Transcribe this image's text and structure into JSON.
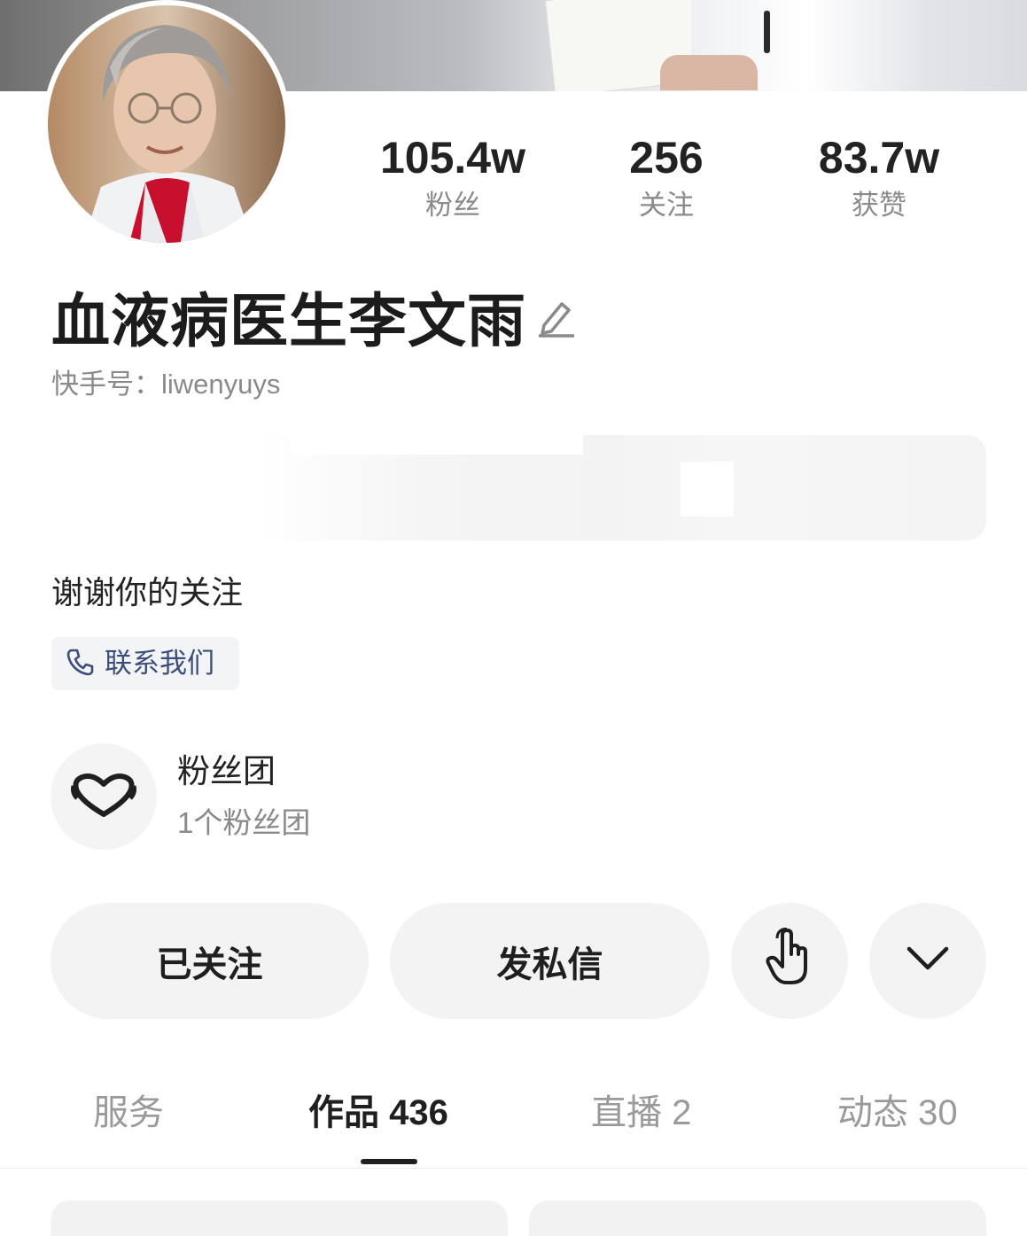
{
  "profile": {
    "name": "血液病医生李文雨",
    "kuaishou_id_label": "快手号：liwenyuys",
    "bio": "谢谢你的关注"
  },
  "stats": [
    {
      "value": "105.4w",
      "label": "粉丝"
    },
    {
      "value": "256",
      "label": "关注"
    },
    {
      "value": "83.7w",
      "label": "获赞"
    }
  ],
  "contact": {
    "label": "联系我们",
    "icon": "phone-icon"
  },
  "fan_club": {
    "title": "粉丝团",
    "subtitle": "1个粉丝团",
    "icon": "heart-icon"
  },
  "actions": {
    "follow_label": "已关注",
    "message_label": "发私信",
    "gesture_icon": "tap-hand-icon",
    "more_icon": "chevron-down-icon"
  },
  "tabs": [
    {
      "label": "服务",
      "active": false
    },
    {
      "label": "作品 436",
      "active": true
    },
    {
      "label": "直播 2",
      "active": false
    },
    {
      "label": "动态 30",
      "active": false
    }
  ],
  "colors": {
    "accent_link": "#3b4d7a",
    "muted_text": "#8a8a8a",
    "button_bg": "#f3f3f3"
  }
}
